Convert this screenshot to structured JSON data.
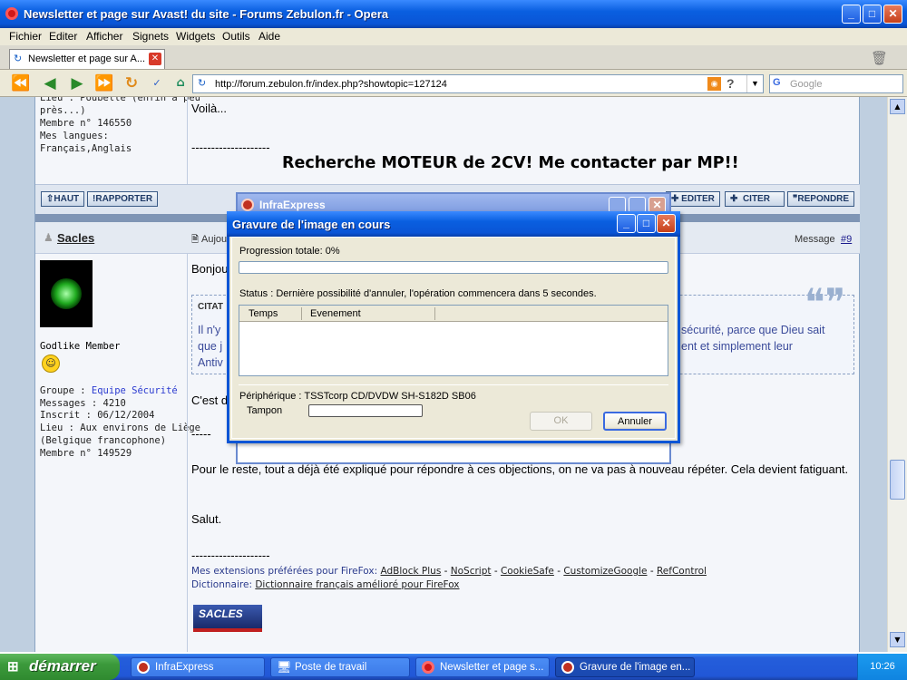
{
  "window": {
    "title": "Newsletter et page sur Avast! du site - Forums Zebulon.fr - Opera"
  },
  "menu": [
    "Fichier",
    "Editer",
    "Afficher",
    "Signets",
    "Widgets",
    "Outils",
    "Aide"
  ],
  "tab": {
    "label": "Newsletter et page sur A..."
  },
  "address": {
    "url": "http://forum.zebulon.fr/index.php?showtopic=127124"
  },
  "search": {
    "placeholder": "Google"
  },
  "post1": {
    "info": [
      "Lieu : Poubelle (enfin à peu",
      "près...)",
      "Membre n° 146550",
      "Mes langues:",
      "Français,Anglais"
    ],
    "text": "Voilà...",
    "dashes": "--------------------",
    "signature": "Recherche MOTEUR de 2CV! Me contacter par MP!!",
    "btn_haut": "HAUT",
    "btn_rapporter": "RAPPORTER",
    "btn_editer": "EDITER",
    "btn_citer": "CITER",
    "btn_repondre": "REPONDRE"
  },
  "post2": {
    "author": "Sacles",
    "date_prefix": "Aujou",
    "message_label": "Message",
    "message_num": "#9",
    "rank": "Godlike Member",
    "group_label": "Groupe :",
    "group": "Equipe Sécurité",
    "info": [
      "Messages : 4210",
      "Inscrit : 06/12/2004",
      "Lieu : Aux environs de Liège",
      "(Belgique francophone)",
      "Membre n° 149529"
    ],
    "greeting": "Bonjou",
    "quote_label": "CITAT",
    "quote_lines": [
      "Il n'y",
      "que j",
      "Antiv"
    ],
    "quote_right1": "sécurité, parce que Dieu sait",
    "quote_right2": "ent et simplement leur",
    "c_est": "C'est d",
    "dashes": "-----",
    "para": "Pour le reste, tout a déjà été expliqué pour répondre à ces objections, on ne va pas à nouveau répéter. Cela devient fatiguant.",
    "salut": "Salut.",
    "dashes2": "--------------------",
    "ext_label": "Mes extensions préférées pour FireFox:",
    "ext_links": [
      "AdBlock Plus",
      "NoScript",
      "CookieSafe",
      "CustomizeGoogle",
      "RefControl"
    ],
    "dict_label": "Dictionnaire:",
    "dict_link": "Dictionnaire français amélioré pour FireFox",
    "banner": "SACLES"
  },
  "infra": {
    "title": "InfraExpress"
  },
  "dialog": {
    "title": "Gravure de l'image en cours",
    "progress_label": "Progression totale: 0%",
    "progress": 0,
    "status": "Status : Dernière possibilité d'annuler, l'opération commencera dans 5 secondes.",
    "col_time": "Temps",
    "col_event": "Evenement",
    "device": "Périphérique : TSSTcorp CD/DVDW SH-S182D SB06",
    "buffer_label": "Tampon",
    "ok": "OK",
    "cancel": "Annuler"
  },
  "taskbar": {
    "start": "démarrer",
    "tasks": [
      "InfraExpress",
      "Poste de travail",
      "Newsletter et page s...",
      "Gravure de l'image en..."
    ],
    "clock": "10:26"
  }
}
